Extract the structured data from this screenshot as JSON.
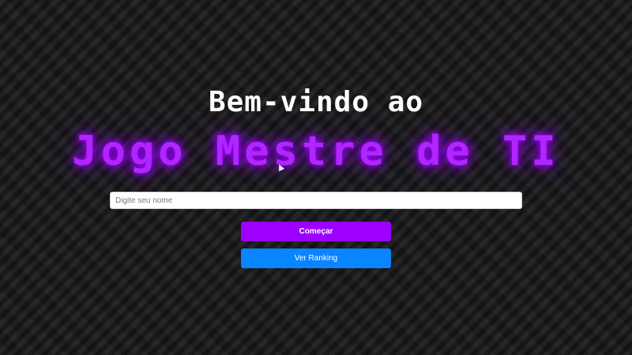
{
  "welcome": {
    "text": "Bem-vindo ao"
  },
  "title": {
    "text": "Jogo Mestre de TI",
    "color": "#b026ff"
  },
  "name_input": {
    "placeholder": "Digite seu nome",
    "value": ""
  },
  "buttons": {
    "start_label": "Começar",
    "start_color": "#9d00ff",
    "ranking_label": "Ver Ranking",
    "ranking_color": "#0a84ff"
  },
  "background_color": "#1b1a1d"
}
